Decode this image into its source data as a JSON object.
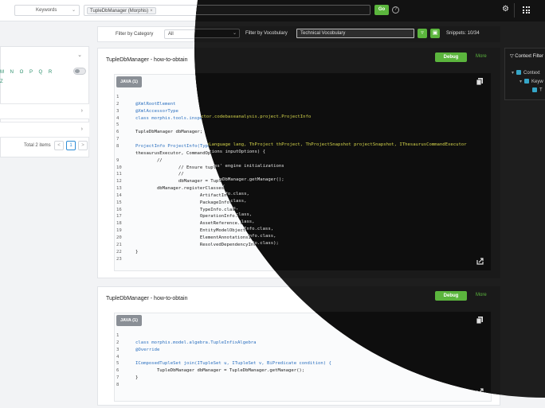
{
  "search": {
    "mode_label": "Keywords",
    "tag": "TupleDbManager (Morphis)",
    "tag_remove": "×",
    "go_label": "Go",
    "help_label": "?"
  },
  "filters": {
    "category_label": "Filter by Category",
    "category_value": "All",
    "vocabulary_label": "Filter by Vocobulary",
    "vocabulary_value": "Technical Vocobulary",
    "snippets": "Snippets: 10/34"
  },
  "left_panel": {
    "alphabet": "M N O P Q R",
    "alphabet_last": "Z",
    "pager_total": "Total 2 items",
    "page_prev": "<",
    "page_current": "1",
    "page_next": ">"
  },
  "context_filter": {
    "title": "Context Filter",
    "items": [
      "Context",
      "Keyw",
      "T"
    ]
  },
  "snippets": [
    {
      "title": "TupleDbManager - how-to-obtain",
      "language": "JAVA (1)",
      "debug_label": "Debug",
      "more_label": "More",
      "lines": [
        {
          "n": "1",
          "text": "",
          "cls": "plain"
        },
        {
          "n": "2",
          "text": "@XmlRootElement",
          "cls": "ann"
        },
        {
          "n": "3",
          "text": "@XmlAccessorType",
          "cls": "ann"
        },
        {
          "n": "4",
          "text": "class morphis.tools.inspector.codebaseanalysis.project.ProjectInfo",
          "cls": "kw"
        },
        {
          "n": "5",
          "text": "",
          "cls": "plain"
        },
        {
          "n": "6",
          "text": "TupleDbManager dbManager;",
          "cls": "plain"
        },
        {
          "n": "7",
          "text": "",
          "cls": "plain"
        },
        {
          "n": "8",
          "text": "ProjectInfo ProjectInfo(TypeLanguage lang, ThProject thProject, ThProjectSnapshot projectSnapshot, IThesaurusCommandExecutor",
          "cls": "cls"
        },
        {
          "n": "",
          "text": "thesaurusExecutor, CommandOptions inputOptions) {",
          "cls": "plain"
        },
        {
          "n": "9",
          "text": "        //",
          "cls": "plain"
        },
        {
          "n": "10",
          "text": "                // Ensure tuples' engine initializations",
          "cls": "plain"
        },
        {
          "n": "11",
          "text": "                //",
          "cls": "plain"
        },
        {
          "n": "12",
          "text": "                dbManager = TupleDbManager.getManager();",
          "cls": "plain"
        },
        {
          "n": "13",
          "text": "        dbManager.registerClasses(",
          "cls": "plain"
        },
        {
          "n": "14",
          "text": "                        ArtifactInfo.class,",
          "cls": "plain"
        },
        {
          "n": "15",
          "text": "                        PackageInfo.class,",
          "cls": "plain"
        },
        {
          "n": "16",
          "text": "                        TypeInfo.class,",
          "cls": "plain"
        },
        {
          "n": "17",
          "text": "                        OperationInfo.class,",
          "cls": "plain"
        },
        {
          "n": "18",
          "text": "                        AssetReference.class,",
          "cls": "plain"
        },
        {
          "n": "19",
          "text": "                        EntityModelObjectInfo.class,",
          "cls": "plain"
        },
        {
          "n": "20",
          "text": "                        ElementAnnotationsInfo.class,",
          "cls": "plain"
        },
        {
          "n": "21",
          "text": "                        ResolvedDependencyInfo.class);",
          "cls": "plain"
        },
        {
          "n": "22",
          "text": "}",
          "cls": "plain"
        },
        {
          "n": "23",
          "text": "",
          "cls": "plain"
        }
      ]
    },
    {
      "title": "TupleDbManager - how-to-obtain",
      "language": "JAVA (1)",
      "debug_label": "Debug",
      "more_label": "More",
      "lines": [
        {
          "n": "1",
          "text": "",
          "cls": "plain"
        },
        {
          "n": "2",
          "text": "class morphis.model.algebra.TupleInfixAlgebra",
          "cls": "kw"
        },
        {
          "n": "3",
          "text": "@Override",
          "cls": "ann"
        },
        {
          "n": "4",
          "text": "",
          "cls": "plain"
        },
        {
          "n": "5",
          "text": "IComposedTupleSet join(ITupleSet u, ITupleSet v, BiPredicate condition) {",
          "cls": "cls"
        },
        {
          "n": "6",
          "text": "        TupleDbManager dbManager = TupleDbManager.getManager();",
          "cls": "plain"
        },
        {
          "n": "7",
          "text": "}",
          "cls": "plain"
        },
        {
          "n": "8",
          "text": "",
          "cls": "plain"
        }
      ]
    }
  ],
  "colors": {
    "accent_green": "#5bb53d",
    "dark_bg": "#1e1e1e",
    "code_bg": "#0e0e0e",
    "annotation_yellow": "#d3d34a",
    "checkbox_blue": "#35a6c8"
  }
}
